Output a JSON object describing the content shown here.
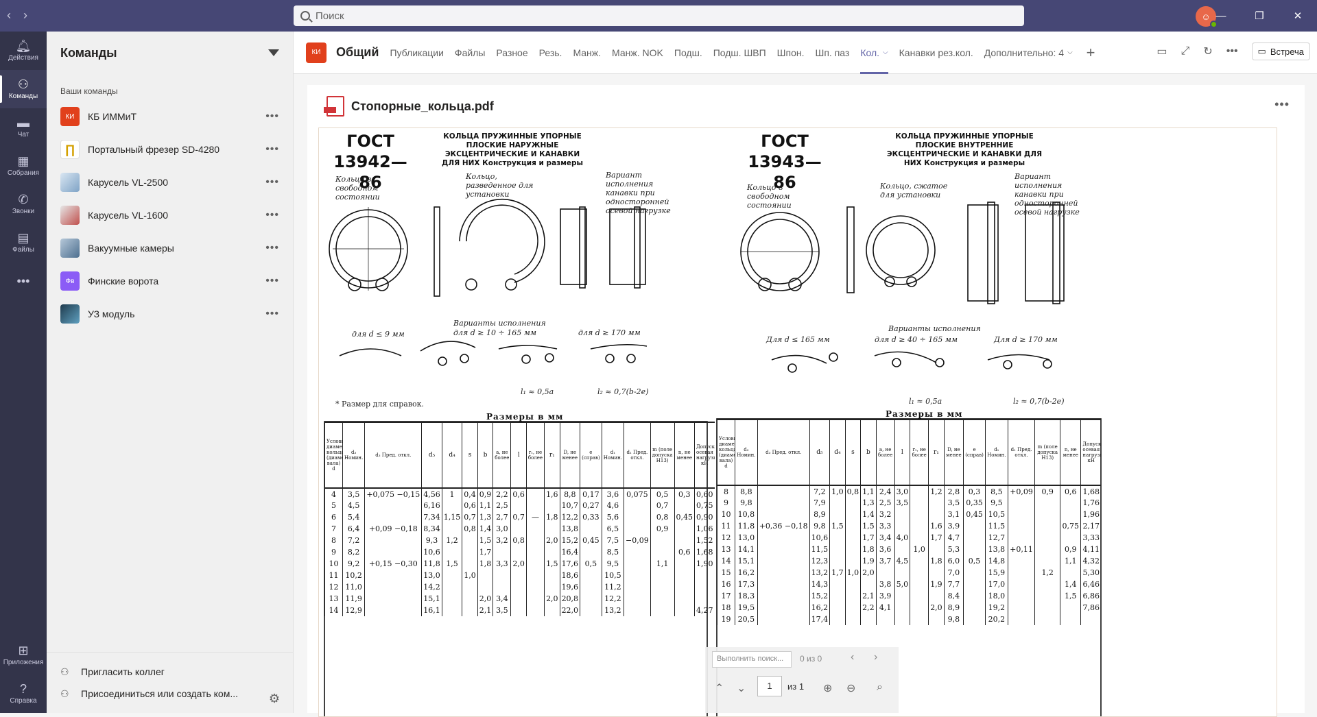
{
  "search": {
    "placeholder": "Поиск"
  },
  "rail": [
    {
      "label": "Действия",
      "icon": "bell-icon"
    },
    {
      "label": "Команды",
      "icon": "teams-icon"
    },
    {
      "label": "Чат",
      "icon": "chat-icon"
    },
    {
      "label": "Собрания",
      "icon": "calendar-icon"
    },
    {
      "label": "Звонки",
      "icon": "phone-icon"
    },
    {
      "label": "Файлы",
      "icon": "files-icon"
    },
    {
      "label": "Приложения",
      "icon": "apps-icon"
    },
    {
      "label": "Справка",
      "icon": "help-icon"
    }
  ],
  "teams": {
    "title": "Команды",
    "section": "Ваши команды",
    "items": [
      {
        "name": "КБ ИММиТ",
        "badge": "КИ",
        "color": "#e1401c"
      },
      {
        "name": "Портальный фрезер SD-4280",
        "color": "#f0c000"
      },
      {
        "name": "Карусель VL-2500",
        "color": "#8aa9c9"
      },
      {
        "name": "Карусель VL-1600",
        "color": "#c0504d"
      },
      {
        "name": "Вакуумные камеры",
        "color": "#6d8fb0"
      },
      {
        "name": "Финские ворота",
        "badge": "Фв",
        "color": "#8b5cf6"
      },
      {
        "name": "УЗ модуль",
        "color": "#3a6f8f"
      }
    ],
    "footer": {
      "invite": "Пригласить коллег",
      "join": "Присоединиться или создать ком..."
    }
  },
  "channel": {
    "badge": "КИ",
    "name": "Общий",
    "tabs": [
      "Публикации",
      "Файлы",
      "Разное",
      "Резь.",
      "Манж.",
      "Манж. NOK",
      "Подш.",
      "Подш. ШВП",
      "Шпон.",
      "Шп. паз",
      "Кол.",
      "Канавки рез.кол.",
      "Дополнительно: 4"
    ],
    "active_tab": "Кол.",
    "meet_button": "Встреча"
  },
  "document": {
    "title": "Стопорные_кольца.pdf",
    "left": {
      "gost": "ГОСТ 13942—86",
      "gost_line1": "ГОСТ",
      "gost_line2": "13942—86",
      "header": "КОЛЬЦА ПРУЖИННЫЕ УПОРНЫЕ ПЛОСКИЕ НАРУЖНЫЕ ЭКСЦЕНТРИЧЕСКИЕ И КАНАВКИ ДЛЯ НИХ Конструкция и размеры",
      "labels": {
        "free": "Кольцо в свободном состоянии",
        "spread": "Кольцо, разведенное для установки",
        "variant": "Вариант исполнения канавки при односторонней осевой нагрузке",
        "variants": "Варианты исполнения",
        "d_le9": "для d ≤ 9 мм",
        "d_range": "для d ≥ 10 ÷ 165 мм",
        "d_ge170": "для d ≥ 170 мм",
        "l1": "l₁ ≈ 0,5a",
        "l2": "l₂ ≈ 0,7(b-2e)",
        "footnote": "* Размер для справок."
      },
      "dims_title": "Размеры в мм",
      "headers": [
        "Условный диаметр кольца (диаметр вала) d",
        "d₃ Номин.",
        "d₃ Пред. откл.",
        "d₅",
        "d₄",
        "s",
        "b",
        "a, не более",
        "l",
        "r₁, не более",
        "r₁",
        "D, не менее",
        "e (справ)",
        "d₁ Номин.",
        "d₁ Пред. откл.",
        "m (поле допуска H13)",
        "n, не менее",
        "Допускаемая осевая нагрузка, кН"
      ],
      "rows": [
        [
          "4",
          "3,5",
          "+0,075 −0,15",
          "4,56",
          "1",
          "0,4",
          "0,9",
          "2,2",
          "0,6",
          "",
          "1,6",
          "8,8",
          "0,17",
          "3,6",
          "0,075",
          "0,5",
          "0,3",
          "0,60"
        ],
        [
          "5",
          "4,5",
          "",
          "6,16",
          "",
          "0,6",
          "1,1",
          "2,5",
          "",
          "",
          "",
          "10,7",
          "0,27",
          "4,6",
          "",
          "0,7",
          "",
          "0,75"
        ],
        [
          "6",
          "5,4",
          "",
          "7,34",
          "1,15",
          "0,7",
          "1,3",
          "2,7",
          "0,7",
          "—",
          "1,8",
          "12,2",
          "0,33",
          "5,6",
          "",
          "0,8",
          "0,45",
          "0,90"
        ],
        [
          "7",
          "6,4",
          "+0,09 −0,18",
          "8,34",
          "",
          "0,8",
          "1,4",
          "3,0",
          "",
          "",
          "",
          "13,8",
          "",
          "6,5",
          "",
          "0,9",
          "",
          "1,06"
        ],
        [
          "8",
          "7,2",
          "",
          "9,3",
          "1,2",
          "",
          "1,5",
          "3,2",
          "0,8",
          "",
          "2,0",
          "15,2",
          "0,45",
          "7,5",
          "−0,09",
          "",
          "",
          "1,52"
        ],
        [
          "9",
          "8,2",
          "",
          "10,6",
          "",
          "",
          "1,7",
          "",
          "",
          "",
          "",
          "16,4",
          "",
          "8,5",
          "",
          "",
          "0,6",
          "1,68"
        ],
        [
          "10",
          "9,2",
          "+0,15 −0,30",
          "11,8",
          "1,5",
          "",
          "1,8",
          "3,3",
          "2,0",
          "",
          "1,5",
          "17,6",
          "0,5",
          "9,5",
          "",
          "1,1",
          "",
          "1,90"
        ],
        [
          "11",
          "10,2",
          "",
          "13,0",
          "",
          "1,0",
          "",
          "",
          "",
          "",
          "",
          "18,6",
          "",
          "10,5",
          "",
          "",
          "",
          ""
        ],
        [
          "12",
          "11,0",
          "",
          "14,2",
          "",
          "",
          "",
          "",
          "",
          "",
          "",
          "19,6",
          "",
          "11,2",
          "",
          "",
          "",
          ""
        ],
        [
          "13",
          "11,9",
          "",
          "15,1",
          "",
          "",
          "2,0",
          "3,4",
          "",
          "",
          "2,0",
          "20,8",
          "",
          "12,2",
          "",
          "",
          "",
          ""
        ],
        [
          "14",
          "12,9",
          "",
          "16,1",
          "",
          "",
          "2,1",
          "3,5",
          "",
          "",
          "",
          "22,0",
          "",
          "13,2",
          "",
          "",
          "",
          "4,27"
        ]
      ]
    },
    "right": {
      "gost": "ГОСТ 13943—86",
      "gost_line1": "ГОСТ",
      "gost_line2": "13943—86",
      "header": "КОЛЬЦА ПРУЖИННЫЕ УПОРНЫЕ ПЛОСКИЕ ВНУТРЕННИЕ ЭКСЦЕНТРИЧЕСКИЕ И КАНАВКИ ДЛЯ НИХ Конструкция и размеры",
      "labels": {
        "free": "Кольцо в свободном состоянии",
        "compressed": "Кольцо, сжатое для установки",
        "variant": "Вариант исполнения канавки при односторонней осевой нагрузке",
        "variants": "Варианты исполнения",
        "d_le165": "Для d ≤ 165 мм",
        "d_range": "для d ≥ 40 ÷ 165 мм",
        "d_ge170": "Для d ≥ 170 мм",
        "l1": "l₁ ≈ 0,5a",
        "l2": "l₂ ≈ 0,7(b-2e)"
      },
      "dims_title": "Размеры в мм",
      "rows": [
        [
          "8",
          "8,8",
          "",
          "7,2",
          "1,0",
          "0,8",
          "1,1",
          "2,4",
          "3,0",
          "",
          "1,2",
          "2,8",
          "0,3",
          "8,5",
          "+0,09",
          "0,9",
          "0,6",
          "1,68"
        ],
        [
          "9",
          "9,8",
          "",
          "7,9",
          "",
          "",
          "1,3",
          "2,5",
          "3,5",
          "",
          "",
          "3,5",
          "0,35",
          "9,5",
          "",
          "",
          "",
          "1,76"
        ],
        [
          "10",
          "10,8",
          "",
          "8,9",
          "",
          "",
          "1,4",
          "3,2",
          "",
          "",
          "",
          "3,1",
          "0,45",
          "10,5",
          "",
          "",
          "",
          "1,96"
        ],
        [
          "11",
          "11,8",
          "+0,36 −0,18",
          "9,8",
          "1,5",
          "",
          "1,5",
          "3,3",
          "",
          "",
          "1,6",
          "3,9",
          "",
          "11,5",
          "",
          "",
          "0,75",
          "2,17"
        ],
        [
          "12",
          "13,0",
          "",
          "10,6",
          "",
          "",
          "1,7",
          "3,4",
          "4,0",
          "",
          "1,7",
          "4,7",
          "",
          "12,7",
          "",
          "",
          "",
          "3,33"
        ],
        [
          "13",
          "14,1",
          "",
          "11,5",
          "",
          "",
          "1,8",
          "3,6",
          "",
          "1,0",
          "",
          "5,3",
          "",
          "13,8",
          "+0,11",
          "",
          "0,9",
          "4,11"
        ],
        [
          "14",
          "15,1",
          "",
          "12,3",
          "",
          "",
          "1,9",
          "3,7",
          "4,5",
          "",
          "1,8",
          "6,0",
          "0,5",
          "14,8",
          "",
          "",
          "1,1",
          "4,32"
        ],
        [
          "15",
          "16,2",
          "",
          "13,2",
          "1,7",
          "1,0",
          "2,0",
          "",
          "",
          "",
          "",
          "7,0",
          "",
          "15,9",
          "",
          "1,2",
          "",
          "5,30"
        ],
        [
          "16",
          "17,3",
          "",
          "14,3",
          "",
          "",
          "",
          "3,8",
          "5,0",
          "",
          "1,9",
          "7,7",
          "",
          "17,0",
          "",
          "",
          "1,4",
          "6,46"
        ],
        [
          "17",
          "18,3",
          "",
          "15,2",
          "",
          "",
          "2,1",
          "3,9",
          "",
          "",
          "",
          "8,4",
          "",
          "18,0",
          "",
          "",
          "1,5",
          "6,86"
        ],
        [
          "18",
          "19,5",
          "",
          "16,2",
          "",
          "",
          "2,2",
          "4,1",
          "",
          "",
          "2,0",
          "8,9",
          "",
          "19,2",
          "",
          "",
          "",
          "7,86"
        ],
        [
          "19",
          "20,5",
          "",
          "17,4",
          "",
          "",
          "",
          "",
          "",
          "",
          "",
          "9,8",
          "",
          "20,2",
          "",
          "",
          "",
          ""
        ]
      ]
    },
    "toolbar": {
      "search_placeholder": "Выполнить поиск...",
      "count": "0 из 0",
      "page": "1",
      "of": "из 1"
    }
  }
}
